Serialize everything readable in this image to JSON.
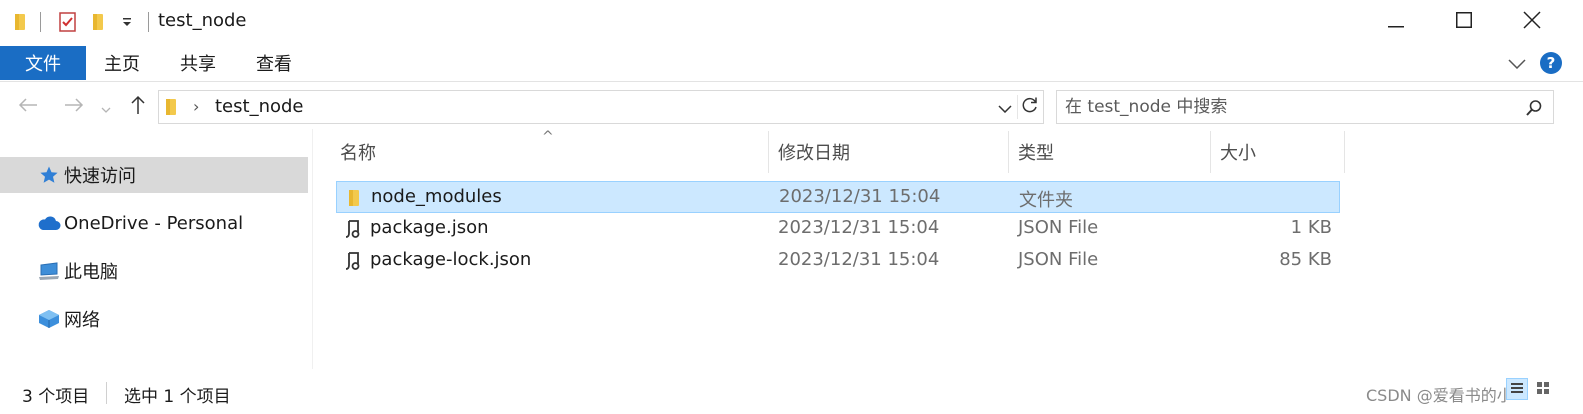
{
  "window": {
    "title": "test_node"
  },
  "quick_access_toolbar": {
    "icons": [
      "folder-icon",
      "properties-check-icon",
      "new-folder-icon",
      "customize-dropdown-icon"
    ]
  },
  "window_controls": {
    "icons": [
      "minimize-icon",
      "maximize-icon",
      "close-icon"
    ]
  },
  "ribbon": {
    "tabs": [
      {
        "label": "文件",
        "active": true
      },
      {
        "label": "主页"
      },
      {
        "label": "共享"
      },
      {
        "label": "查看"
      }
    ],
    "help_label": "?"
  },
  "address_bar": {
    "path_segments": [
      "test_node"
    ],
    "separator": "›"
  },
  "search": {
    "placeholder": "在 test_node 中搜索"
  },
  "nav_pane": {
    "items": [
      {
        "label": "快速访问",
        "icon": "star-icon",
        "selected": true
      },
      {
        "label": "OneDrive - Personal",
        "icon": "cloud-icon"
      },
      {
        "label": "此电脑",
        "icon": "computer-icon"
      },
      {
        "label": "网络",
        "icon": "network-icon"
      }
    ]
  },
  "file_list": {
    "columns": [
      "名称",
      "修改日期",
      "类型",
      "大小"
    ],
    "sort_indicator": "^",
    "rows": [
      {
        "name": "node_modules",
        "modified": "2023/12/31 15:04",
        "type": "文件夹",
        "size": "",
        "icon": "folder-icon",
        "selected": true
      },
      {
        "name": "package.json",
        "modified": "2023/12/31 15:04",
        "type": "JSON File",
        "size": "1 KB",
        "icon": "json-file-icon"
      },
      {
        "name": "package-lock.json",
        "modified": "2023/12/31 15:04",
        "type": "JSON File",
        "size": "85 KB",
        "icon": "json-file-icon"
      }
    ]
  },
  "status_bar": {
    "item_count": "3 个项目",
    "selection": "选中 1 个项目",
    "watermark": "CSDN @爱看书的小",
    "view_modes": [
      "details-view-icon",
      "large-icons-view-icon"
    ]
  },
  "colors": {
    "accent": "#1a6dc4",
    "selection_bg": "#cce8ff",
    "selection_border": "#99d1ff",
    "folder": "#f3c94c"
  }
}
